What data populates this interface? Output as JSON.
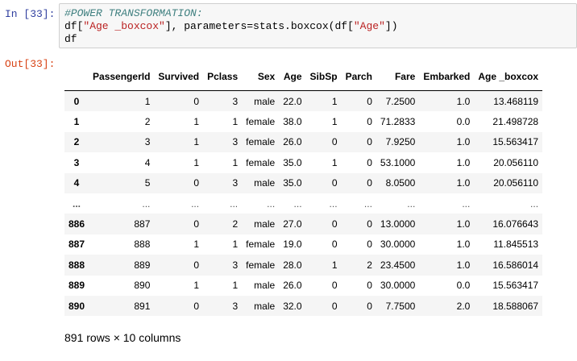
{
  "cell": {
    "in_prompt": "In [33]:",
    "out_prompt": "Out[33]:",
    "code": {
      "comment": "#POWER TRANSFORMATION:",
      "line2_pre": "df[",
      "line2_str1": "\"Age _boxcox\"",
      "line2_mid": "], parameters=stats.boxcox(df[",
      "line2_str2": "\"Age\"",
      "line2_post": "])",
      "line3": "df"
    }
  },
  "table": {
    "index_header": "",
    "columns": [
      "PassengerId",
      "Survived",
      "Pclass",
      "Sex",
      "Age",
      "SibSp",
      "Parch",
      "Fare",
      "Embarked",
      "Age _boxcox"
    ],
    "rows": [
      {
        "index": "0",
        "cells": [
          "1",
          "0",
          "3",
          "male",
          "22.0",
          "1",
          "0",
          "7.2500",
          "1.0",
          "13.468119"
        ]
      },
      {
        "index": "1",
        "cells": [
          "2",
          "1",
          "1",
          "female",
          "38.0",
          "1",
          "0",
          "71.2833",
          "0.0",
          "21.498728"
        ]
      },
      {
        "index": "2",
        "cells": [
          "3",
          "1",
          "3",
          "female",
          "26.0",
          "0",
          "0",
          "7.9250",
          "1.0",
          "15.563417"
        ]
      },
      {
        "index": "3",
        "cells": [
          "4",
          "1",
          "1",
          "female",
          "35.0",
          "1",
          "0",
          "53.1000",
          "1.0",
          "20.056110"
        ]
      },
      {
        "index": "4",
        "cells": [
          "5",
          "0",
          "3",
          "male",
          "35.0",
          "0",
          "0",
          "8.0500",
          "1.0",
          "20.056110"
        ]
      },
      {
        "index": "...",
        "cells": [
          "...",
          "...",
          "...",
          "...",
          "...",
          "...",
          "...",
          "...",
          "...",
          "..."
        ]
      },
      {
        "index": "886",
        "cells": [
          "887",
          "0",
          "2",
          "male",
          "27.0",
          "0",
          "0",
          "13.0000",
          "1.0",
          "16.076643"
        ]
      },
      {
        "index": "887",
        "cells": [
          "888",
          "1",
          "1",
          "female",
          "19.0",
          "0",
          "0",
          "30.0000",
          "1.0",
          "11.845513"
        ]
      },
      {
        "index": "888",
        "cells": [
          "889",
          "0",
          "3",
          "female",
          "28.0",
          "1",
          "2",
          "23.4500",
          "1.0",
          "16.586014"
        ]
      },
      {
        "index": "889",
        "cells": [
          "890",
          "1",
          "1",
          "male",
          "26.0",
          "0",
          "0",
          "30.0000",
          "0.0",
          "15.563417"
        ]
      },
      {
        "index": "890",
        "cells": [
          "891",
          "0",
          "3",
          "male",
          "32.0",
          "0",
          "0",
          "7.7500",
          "2.0",
          "18.588067"
        ]
      }
    ]
  },
  "shape_note": "891 rows × 10 columns",
  "colors": {
    "in_prompt": "#303f9f",
    "out_prompt": "#d84315",
    "comment": "#408080",
    "string": "#ba2121",
    "input_bg": "#f7f7f7",
    "row_stripe": "#f5f5f5"
  }
}
